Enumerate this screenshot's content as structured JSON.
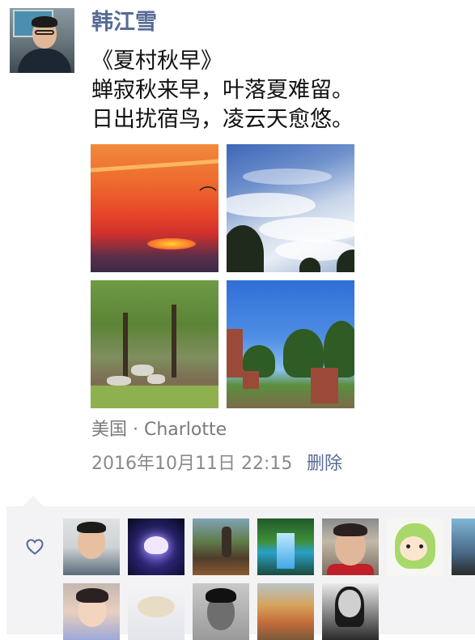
{
  "post": {
    "author": "韩江雪",
    "poem_lines": [
      "《夏村秋早》",
      "蝉寂秋来早，叶落夏难留。",
      "日出扰宿鸟，凌云天愈悠。"
    ],
    "photos": [
      {
        "label": "sunset-with-bird"
      },
      {
        "label": "cloudy-sky"
      },
      {
        "label": "garden-with-trees"
      },
      {
        "label": "park-with-brick-wall"
      }
    ],
    "location": "美国 · Charlotte",
    "timestamp": "2016年10月11日 22:15",
    "delete_label": "删除"
  },
  "likes": {
    "icon": "heart-outline-icon",
    "accent_color": "#576b95",
    "count_visible": 12
  }
}
